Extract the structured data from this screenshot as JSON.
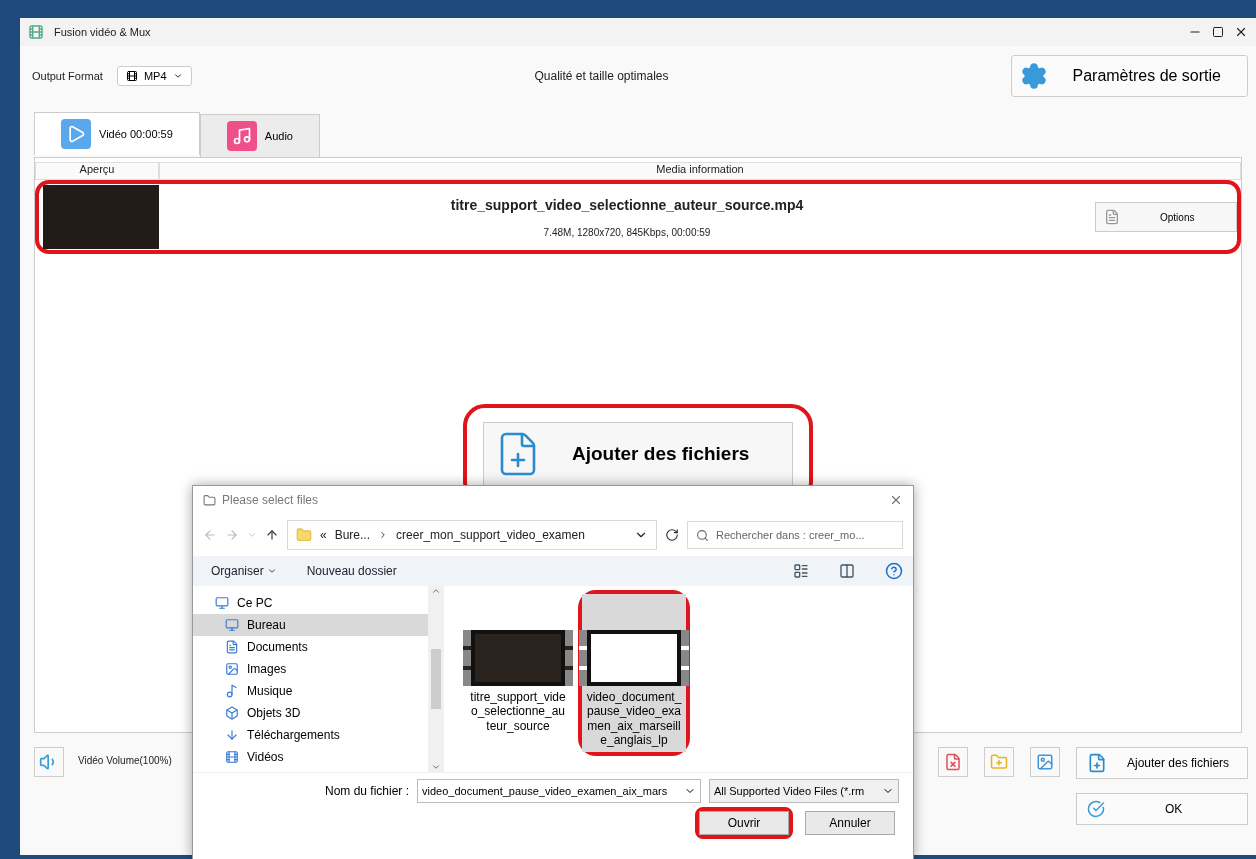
{
  "window": {
    "title": "Fusion vidéo & Mux"
  },
  "toolbar": {
    "format_label": "Output Format",
    "format_value": "MP4",
    "quality": "Qualité et taille optimales",
    "settings_button": "Paramètres de sortie"
  },
  "tabs": [
    {
      "label": "Vidéo 00:00:59",
      "kind": "video",
      "selected": true
    },
    {
      "label": "Audio",
      "kind": "audio",
      "selected": false
    }
  ],
  "table": {
    "columns": [
      "Aperçu",
      "Media information"
    ],
    "rows": [
      {
        "filename": "titre_support_video_selectionne_auteur_source.mp4",
        "details": "7.48M, 1280x720, 845Kbps, 00:00:59",
        "button": "Options",
        "highlighted": true
      }
    ]
  },
  "add_button": {
    "label": "Ajouter des fichiers",
    "highlighted": true
  },
  "bottom": {
    "volume": "Vidéo Volume(100%)",
    "add_files": "Ajouter des fichiers",
    "ok": "OK"
  },
  "dialog": {
    "title": "Please select files",
    "path": {
      "prefix": "«",
      "segments": [
        "Bure...",
        "creer_mon_support_video_examen"
      ]
    },
    "search_placeholder": "Rechercher dans : creer_mo...",
    "commands": {
      "organize": "Organiser",
      "new_folder": "Nouveau dossier"
    },
    "nav": [
      {
        "label": "Ce PC",
        "kind": "pc",
        "selected": false,
        "children": [
          {
            "label": "Bureau",
            "kind": "desktop",
            "selected": true
          },
          {
            "label": "Documents",
            "kind": "docs",
            "selected": false
          },
          {
            "label": "Images",
            "kind": "images",
            "selected": false
          },
          {
            "label": "Musique",
            "kind": "music",
            "selected": false
          },
          {
            "label": "Objets 3D",
            "kind": "cube",
            "selected": false
          },
          {
            "label": "Téléchargements",
            "kind": "download",
            "selected": false
          },
          {
            "label": "Vidéos",
            "kind": "videos",
            "selected": false
          }
        ]
      }
    ],
    "files": [
      {
        "name": "titre_support_video_selectionne_auteur_source",
        "kind": "dark",
        "selected": false,
        "highlighted": false
      },
      {
        "name": "video_document_pause_video_examen_aix_marseille_anglais_lp",
        "kind": "light",
        "selected": true,
        "highlighted": true
      }
    ],
    "filename_label": "Nom du fichier :",
    "filename_value": "video_document_pause_video_examen_aix_mars",
    "filetype": "All Supported Video Files (*.rm",
    "buttons": [
      {
        "label": "Ouvrir",
        "highlighted": true
      },
      {
        "label": "Annuler",
        "highlighted": false
      }
    ]
  }
}
